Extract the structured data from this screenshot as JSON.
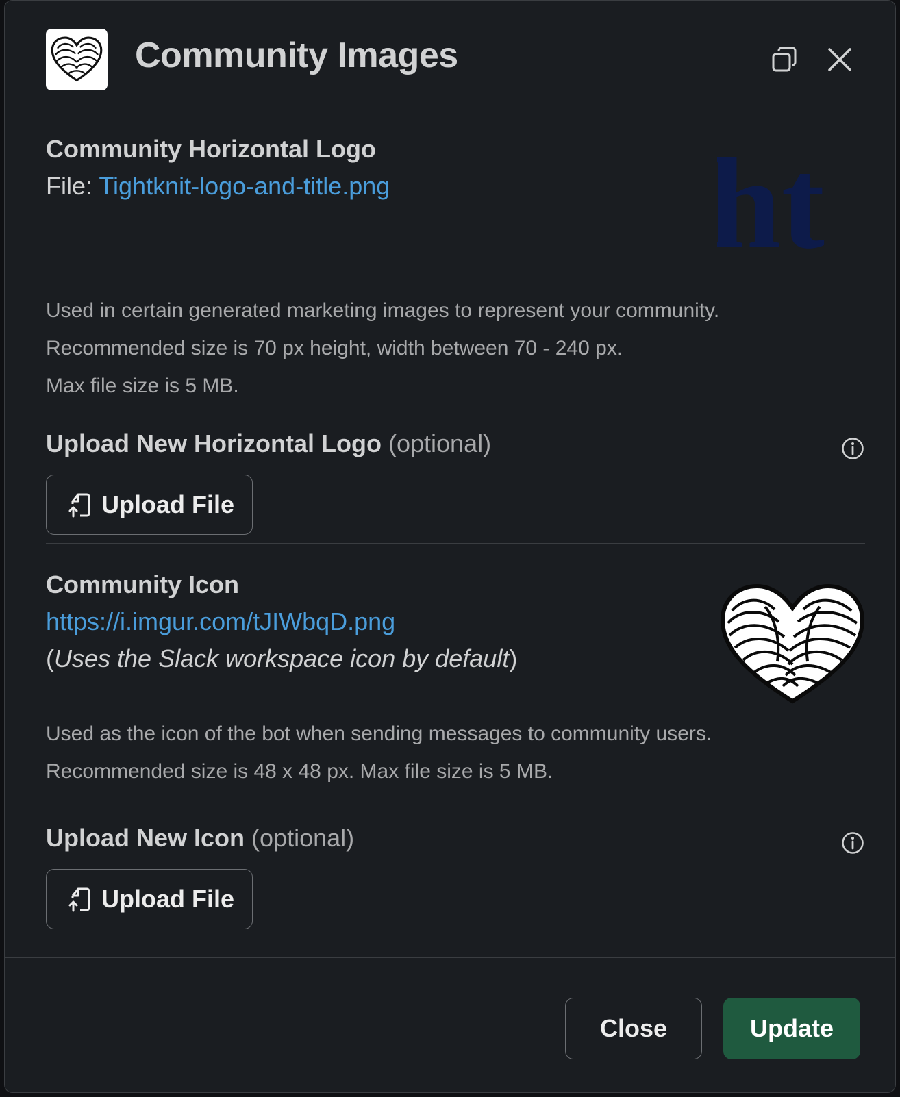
{
  "modal": {
    "title": "Community Images",
    "header_icon": "rope-heart-logo",
    "copy_icon": "copy-window-icon",
    "close_icon": "close-icon"
  },
  "horizontal_logo": {
    "title": "Community Horizontal Logo",
    "file_prefix": "File: ",
    "file_name": "Tightknit-logo-and-title.png",
    "preview_text": "ht",
    "preview_color": "#0d1b4a",
    "desc_line1": "Used in certain generated marketing images to represent your community.",
    "desc_line2": "Recommended size is 70 px height, width between 70 - 240 px.",
    "desc_line3": "Max file size is 5 MB.",
    "upload_label": "Upload New Horizontal Logo",
    "upload_optional": "(optional)",
    "upload_button": "Upload File"
  },
  "community_icon": {
    "title": "Community Icon",
    "url": "https://i.imgur.com/tJIWbqD.png",
    "note_open": "(",
    "note_text": "Uses the Slack workspace icon by default",
    "note_close": ")",
    "desc_line1": "Used as the icon of the bot when sending messages to community users.",
    "desc_line2": "Recommended size is 48 x 48 px. Max file size is 5 MB.",
    "upload_label": "Upload New Icon",
    "upload_optional": "(optional)",
    "upload_button": "Upload File"
  },
  "footer": {
    "close_label": "Close",
    "update_label": "Update",
    "update_color": "#1f5a3f"
  }
}
